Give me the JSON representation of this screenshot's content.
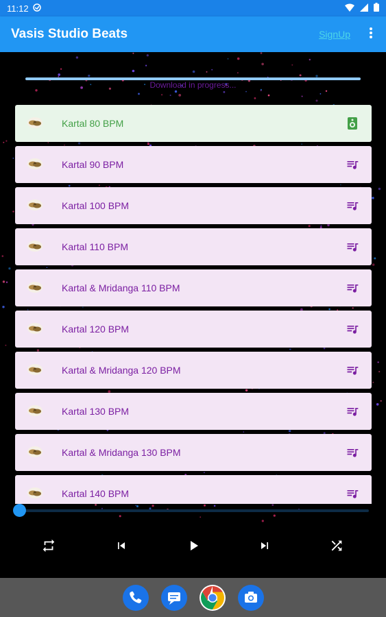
{
  "status_bar": {
    "time": "11:12"
  },
  "app_bar": {
    "title": "Vasis Studio Beats",
    "signup_label": "SignUp"
  },
  "download": {
    "status_text": "Download in progress..."
  },
  "tracks": [
    {
      "label": "Kartal 80 BPM",
      "active": true,
      "action_icon": "download-status-icon"
    },
    {
      "label": "Kartal 90 BPM",
      "active": false,
      "action_icon": "playlist-icon"
    },
    {
      "label": "Kartal 100 BPM",
      "active": false,
      "action_icon": "playlist-icon"
    },
    {
      "label": "Kartal 110 BPM",
      "active": false,
      "action_icon": "playlist-icon"
    },
    {
      "label": "Kartal & Mridanga 110 BPM",
      "active": false,
      "action_icon": "playlist-icon"
    },
    {
      "label": "Kartal 120 BPM",
      "active": false,
      "action_icon": "playlist-icon"
    },
    {
      "label": "Kartal & Mridanga 120 BPM",
      "active": false,
      "action_icon": "playlist-icon"
    },
    {
      "label": "Kartal 130 BPM",
      "active": false,
      "action_icon": "playlist-icon"
    },
    {
      "label": "Kartal & Mridanga 130 BPM",
      "active": false,
      "action_icon": "playlist-icon"
    },
    {
      "label": "Kartal 140 BPM",
      "active": false,
      "action_icon": "playlist-icon"
    }
  ],
  "player": {
    "progress": 0,
    "controls": [
      "repeat-icon",
      "skip-previous-icon",
      "play-icon",
      "skip-next-icon",
      "shuffle-icon"
    ]
  },
  "dock": {
    "apps": [
      "phone-icon",
      "messages-icon",
      "chrome-icon",
      "camera-icon"
    ]
  },
  "colors": {
    "app_bar": "#2196f3",
    "status_bar": "#1a82e8",
    "item_bg": "#f3e5f5",
    "item_active_bg": "#e8f5e9",
    "item_text": "#7b1fa2",
    "item_active_text": "#43a047",
    "signup": "#4dd6e8"
  }
}
